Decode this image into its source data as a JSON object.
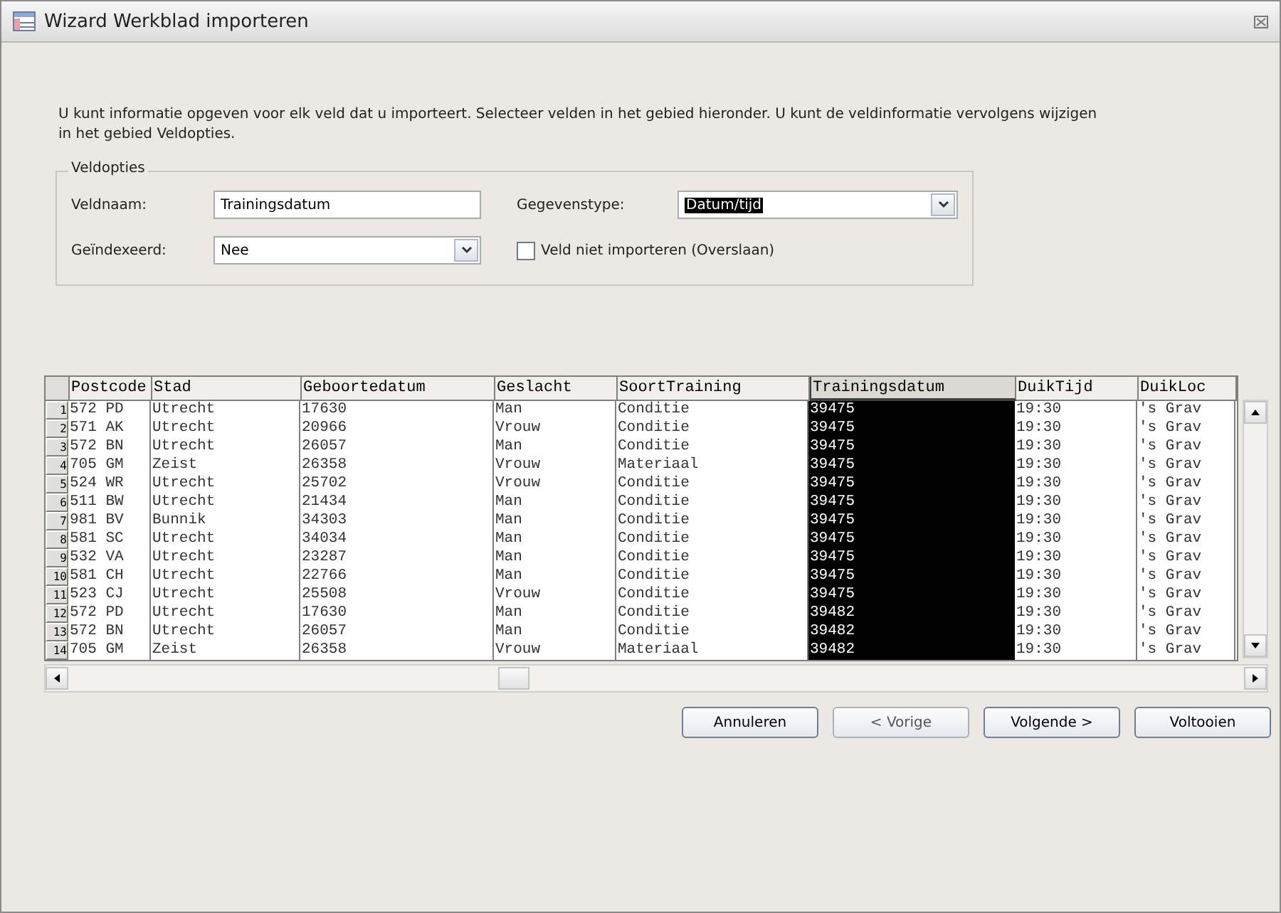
{
  "window": {
    "title": "Wizard Werkblad importeren"
  },
  "intro": "U kunt informatie opgeven voor elk veld dat u importeert. Selecteer velden in het gebied hieronder. U kunt de veldinformatie vervolgens wijzigen in het gebied Veldopties.",
  "field_options": {
    "legend": "Veldopties",
    "field_name": {
      "label": "Veldnaam:",
      "value": "Trainingsdatum"
    },
    "data_type": {
      "label": "Gegevenstype:",
      "value": "Datum/tijd"
    },
    "indexed": {
      "label": "Geïndexeerd:",
      "value": "Nee"
    },
    "skip": {
      "label": "Veld niet importeren (Overslaan)",
      "checked": false
    }
  },
  "table": {
    "columns": [
      {
        "label": "Postcode",
        "selected": false
      },
      {
        "label": "Stad",
        "selected": false
      },
      {
        "label": "Geboortedatum",
        "selected": false
      },
      {
        "label": "Geslacht",
        "selected": false
      },
      {
        "label": "SoortTraining",
        "selected": false
      },
      {
        "label": "Trainingsdatum",
        "selected": true
      },
      {
        "label": "DuikTijd",
        "selected": false
      },
      {
        "label": "DuikLoc",
        "selected": false
      }
    ],
    "rows": [
      {
        "number": "1",
        "cells": [
          "572 PD",
          "Utrecht",
          "17630",
          "Man",
          "Conditie",
          "39475",
          "19:30",
          "'s Grav"
        ]
      },
      {
        "number": "2",
        "cells": [
          "571 AK",
          "Utrecht",
          "20966",
          "Vrouw",
          "Conditie",
          "39475",
          "19:30",
          "'s Grav"
        ]
      },
      {
        "number": "3",
        "cells": [
          "572 BN",
          "Utrecht",
          "26057",
          "Man",
          "Conditie",
          "39475",
          "19:30",
          "'s Grav"
        ]
      },
      {
        "number": "4",
        "cells": [
          "705 GM",
          "Zeist",
          "26358",
          "Vrouw",
          "Materiaal",
          "39475",
          "19:30",
          "'s Grav"
        ]
      },
      {
        "number": "5",
        "cells": [
          "524 WR",
          "Utrecht",
          "25702",
          "Vrouw",
          "Conditie",
          "39475",
          "19:30",
          "'s Grav"
        ]
      },
      {
        "number": "6",
        "cells": [
          "511 BW",
          "Utrecht",
          "21434",
          "Man",
          "Conditie",
          "39475",
          "19:30",
          "'s Grav"
        ]
      },
      {
        "number": "7",
        "cells": [
          "981 BV",
          "Bunnik",
          "34303",
          "Man",
          "Conditie",
          "39475",
          "19:30",
          "'s Grav"
        ]
      },
      {
        "number": "8",
        "cells": [
          "581 SC",
          "Utrecht",
          "34034",
          "Man",
          "Conditie",
          "39475",
          "19:30",
          "'s Grav"
        ]
      },
      {
        "number": "9",
        "cells": [
          "532 VA",
          "Utrecht",
          "23287",
          "Man",
          "Conditie",
          "39475",
          "19:30",
          "'s Grav"
        ]
      },
      {
        "number": "10",
        "cells": [
          "581 CH",
          "Utrecht",
          "22766",
          "Man",
          "Conditie",
          "39475",
          "19:30",
          "'s Grav"
        ]
      },
      {
        "number": "11",
        "cells": [
          "523 CJ",
          "Utrecht",
          "25508",
          "Vrouw",
          "Conditie",
          "39475",
          "19:30",
          "'s Grav"
        ]
      },
      {
        "number": "12",
        "cells": [
          "572 PD",
          "Utrecht",
          "17630",
          "Man",
          "Conditie",
          "39482",
          "19:30",
          "'s Grav"
        ]
      },
      {
        "number": "13",
        "cells": [
          "572 BN",
          "Utrecht",
          "26057",
          "Man",
          "Conditie",
          "39482",
          "19:30",
          "'s Grav"
        ]
      },
      {
        "number": "14",
        "cells": [
          "705 GM",
          "Zeist",
          "26358",
          "Vrouw",
          "Materiaal",
          "39482",
          "19:30",
          "'s Grav"
        ]
      }
    ]
  },
  "buttons": [
    {
      "label": "Annuleren",
      "disabled": false
    },
    {
      "label": "< Vorige",
      "disabled": true
    },
    {
      "label": "Volgende >",
      "disabled": false
    },
    {
      "label": "Voltooien",
      "disabled": false
    }
  ]
}
